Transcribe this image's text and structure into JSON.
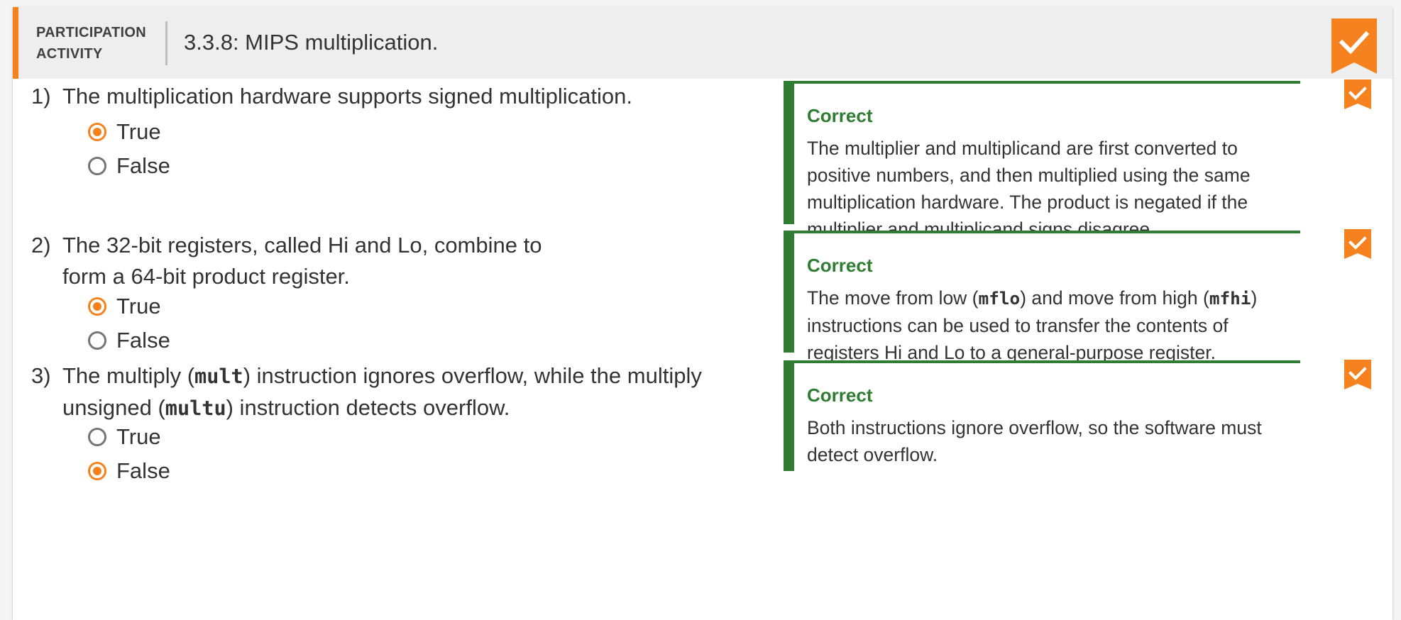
{
  "header": {
    "label_line1": "Participation",
    "label_line2": "Activity",
    "title": "3.3.8: MIPS multiplication.",
    "status_icon": "check-bookmark-icon",
    "accent_color": "#f5821f"
  },
  "questions": [
    {
      "number": "1)",
      "text_parts": [
        "The multiplication hardware supports signed multiplication."
      ],
      "options": [
        {
          "label": "True",
          "selected": true
        },
        {
          "label": "False",
          "selected": false
        }
      ],
      "feedback": {
        "title": "Correct",
        "text": "The multiplier and multiplicand are first converted to positive numbers, and then multiplied using the same multiplication hardware. The product is negated if the multiplier and multiplicand signs disagree."
      }
    },
    {
      "number": "2)",
      "text_parts": [
        "The 32-bit registers, called Hi and Lo, combine to form a 64-bit product register."
      ],
      "options": [
        {
          "label": "True",
          "selected": true
        },
        {
          "label": "False",
          "selected": false
        }
      ],
      "feedback": {
        "title": "Correct",
        "text_before": "The move from low (",
        "code1": "mflo",
        "text_middle": ") and move from high (",
        "code2": "mfhi",
        "text_after": ") instructions can be used to transfer the contents of registers Hi and Lo to a general-purpose register."
      }
    },
    {
      "number": "3)",
      "text_before": "The multiply (",
      "code1": "mult",
      "text_middle": ") instruction ignores overflow, while the multiply unsigned (",
      "code2": "multu",
      "text_after": ") instruction detects overflow.",
      "options": [
        {
          "label": "True",
          "selected": false
        },
        {
          "label": "False",
          "selected": true
        }
      ],
      "feedback": {
        "title": "Correct",
        "text": "Both instructions ignore overflow, so the software must detect overflow."
      }
    }
  ],
  "colors": {
    "correct_green": "#2e7d32",
    "orange": "#f5821f",
    "header_bg": "#eeeeee"
  }
}
